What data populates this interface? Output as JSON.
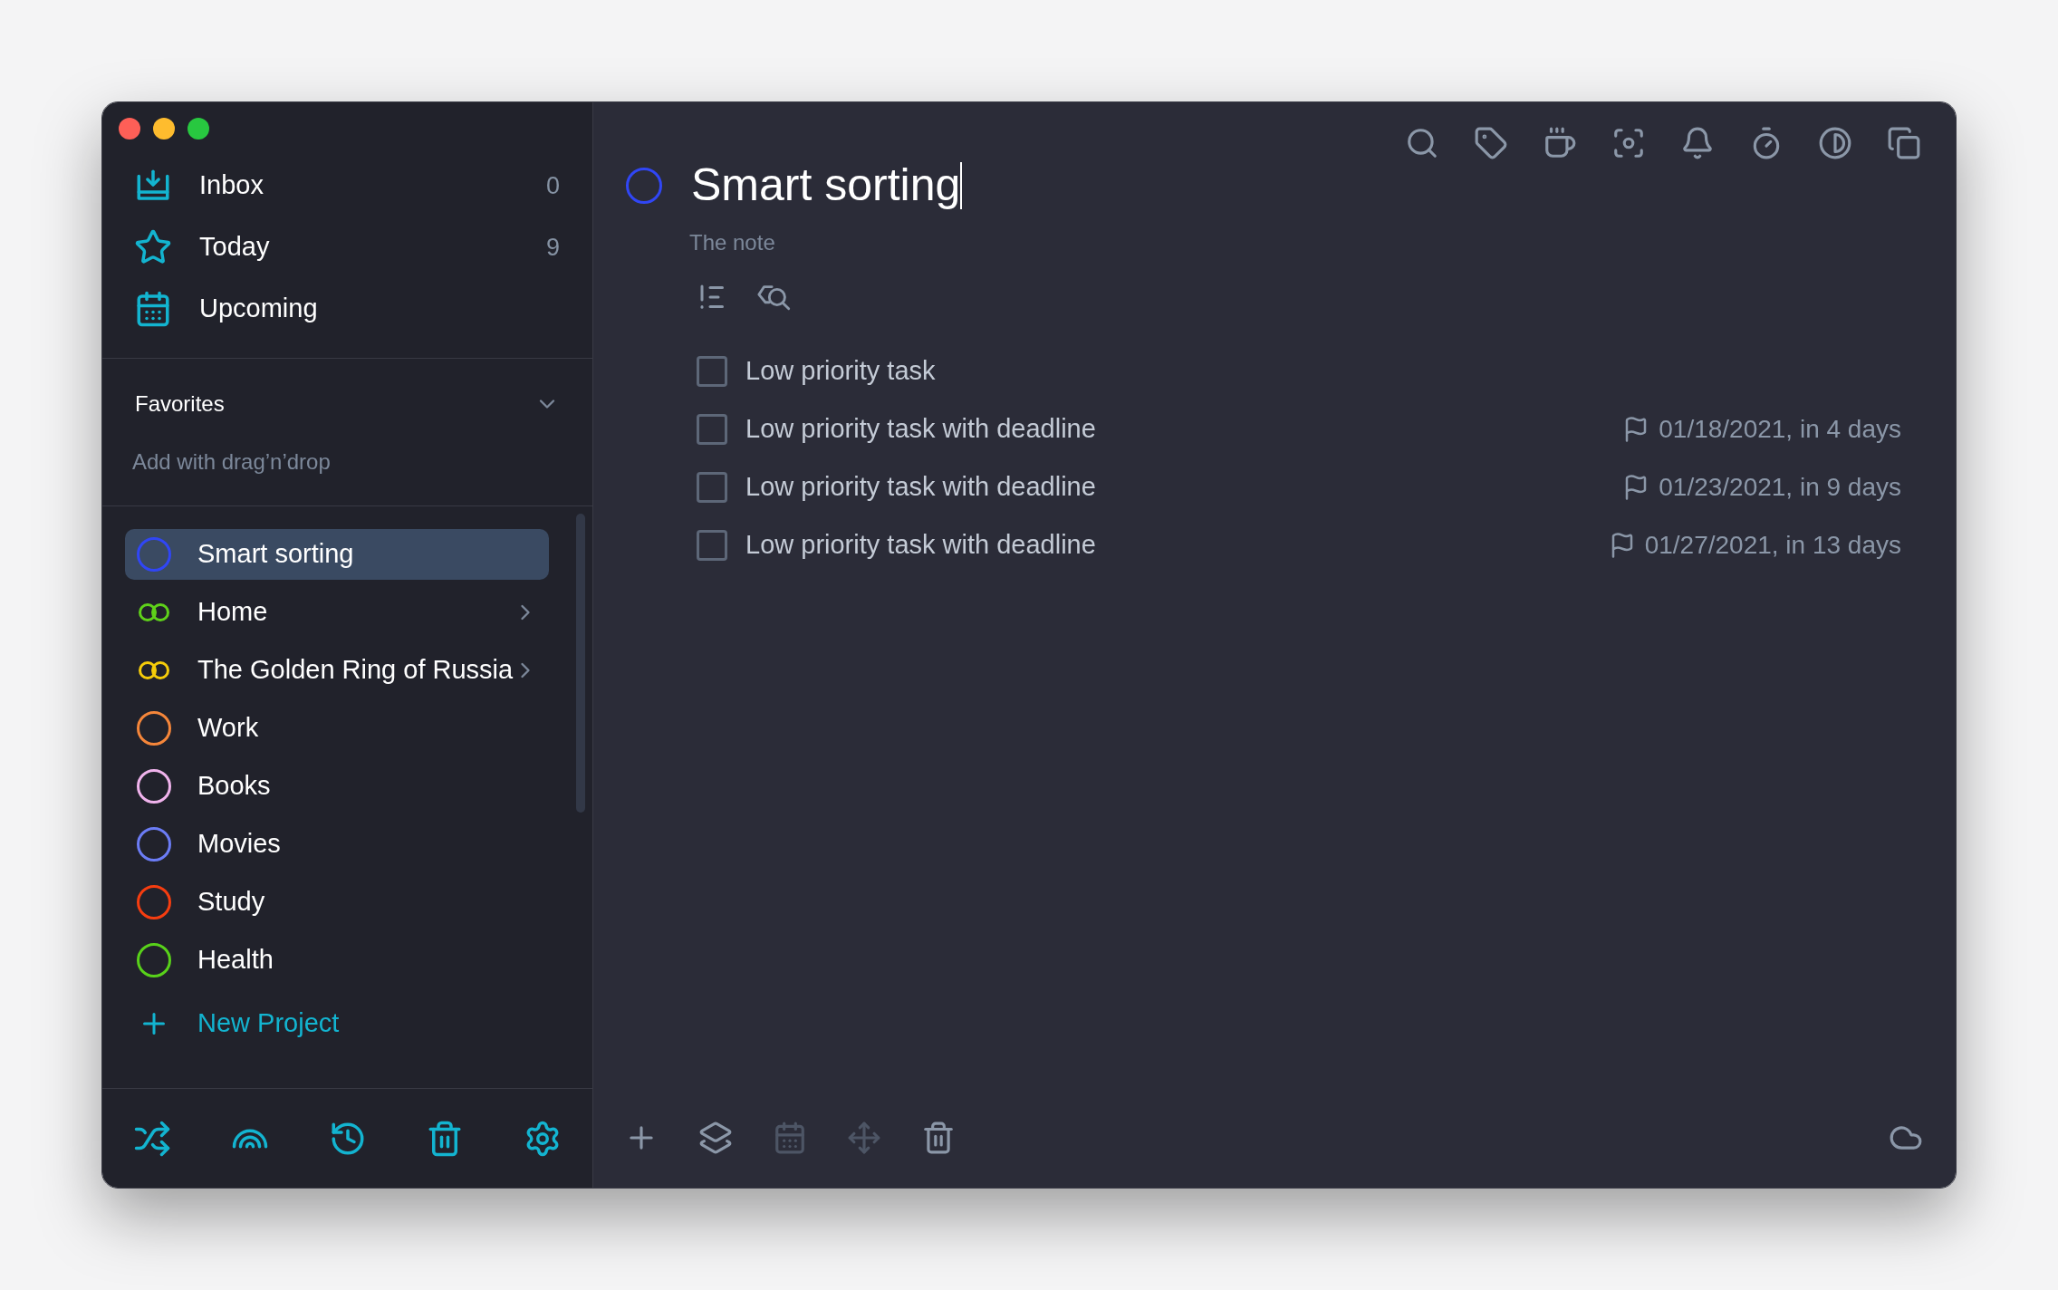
{
  "sidebar": {
    "nav": [
      {
        "kind": "inbox",
        "label": "Inbox",
        "count": "0"
      },
      {
        "kind": "today",
        "label": "Today",
        "count": "9"
      },
      {
        "kind": "upcoming",
        "label": "Upcoming"
      }
    ],
    "favorites": {
      "title": "Favorites",
      "expanded": true,
      "hint": "Add with drag’n’drop"
    },
    "projects": [
      {
        "kind": "single",
        "label": "Smart sorting",
        "color": "#3046f5",
        "selected": true
      },
      {
        "kind": "group",
        "label": "Home",
        "color": "#5fd11a",
        "selected": false,
        "expanded": false
      },
      {
        "kind": "group",
        "label": "The Golden Ring of Russia",
        "color": "#f5cc0a",
        "selected": false,
        "expanded": false
      },
      {
        "kind": "single",
        "label": "Work",
        "color": "#f5863a",
        "selected": false
      },
      {
        "kind": "single",
        "label": "Books",
        "color": "#f0b3ec",
        "selected": false
      },
      {
        "kind": "single",
        "label": "Movies",
        "color": "#6b7cf5",
        "selected": false
      },
      {
        "kind": "single",
        "label": "Study",
        "color": "#f53d10",
        "selected": false
      },
      {
        "kind": "single",
        "label": "Health",
        "color": "#58d11a",
        "selected": false
      }
    ],
    "new_project": "New Project",
    "bottom_tools": [
      {
        "kind": "shuffle"
      },
      {
        "kind": "rainbow"
      },
      {
        "kind": "history"
      },
      {
        "kind": "trash"
      },
      {
        "kind": "settings"
      }
    ]
  },
  "toolbar": [
    {
      "kind": "search"
    },
    {
      "kind": "tag"
    },
    {
      "kind": "coffee"
    },
    {
      "kind": "focus"
    },
    {
      "kind": "bell"
    },
    {
      "kind": "timer"
    },
    {
      "kind": "contrast"
    },
    {
      "kind": "copy"
    }
  ],
  "project": {
    "title": "Smart sorting",
    "color": "#3046f5",
    "note": "The note",
    "tools": [
      {
        "kind": "priority-sort"
      },
      {
        "kind": "tag-search"
      }
    ],
    "tasks": [
      {
        "label": "Low priority task",
        "checked": false
      },
      {
        "label": "Low priority task with deadline",
        "checked": false,
        "deadline": "01/18/2021, in 4 days"
      },
      {
        "label": "Low priority task with deadline",
        "checked": false,
        "deadline": "01/23/2021, in 9 days"
      },
      {
        "label": "Low priority task with deadline",
        "checked": false,
        "deadline": "01/27/2021, in 13 days"
      }
    ]
  },
  "bottom_bar": [
    {
      "kind": "add",
      "disabled": false
    },
    {
      "kind": "layers",
      "disabled": false
    },
    {
      "kind": "calendar",
      "disabled": true
    },
    {
      "kind": "move",
      "disabled": true
    },
    {
      "kind": "trash",
      "disabled": false
    },
    {
      "kind": "cloud",
      "disabled": false
    }
  ]
}
